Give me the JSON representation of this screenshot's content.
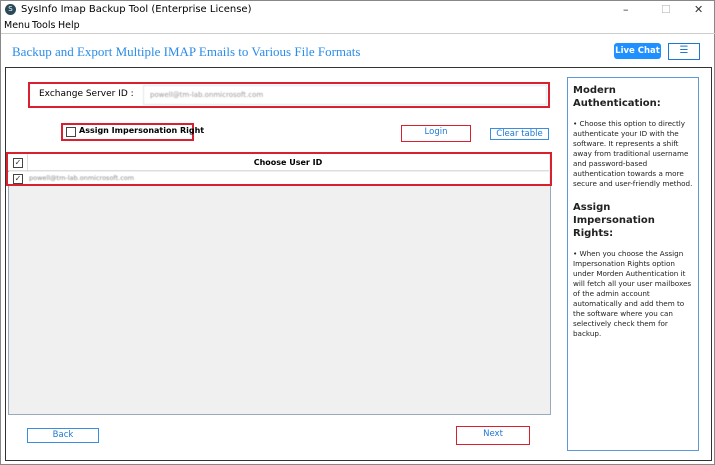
{
  "window": {
    "title": "SysInfo Imap Backup Tool (Enterprise License)",
    "minimize": "–",
    "maximize": "☐",
    "close": "✕"
  },
  "menu": [
    "Menu",
    "Tools",
    "Help"
  ],
  "header": {
    "title": "Backup and Export Multiple IMAP Emails to Various File Formats",
    "live_chat": "Live Chat",
    "menu_icon": "☰"
  },
  "form": {
    "server_label": "Exchange Server ID :",
    "server_value": "powell@tm-lab.onmicrosoft.com",
    "impersonation_label": "Assign Impersonation Right",
    "impersonation_checked": false,
    "login": "Login",
    "clear_table": "Clear table"
  },
  "table": {
    "header": "Choose User ID",
    "rows": [
      {
        "email": "powell@tm-lab.onmicrosoft.com",
        "checked": true
      }
    ]
  },
  "side": {
    "h1": "Modern Authentication:",
    "p1": "• Choose this option to directly authenticate your ID with the software. It represents a shift away from traditional username and password-based authentication towards a more secure and user-friendly method.",
    "h2": "Assign Impersonation Rights:",
    "p2": "• When you choose the Assign Impersonation Rights option under Morden Authentication it will fetch all your user mailboxes of the admin account automatically and add them to the software where you can selectively check them for backup."
  },
  "footer": {
    "back": "Back",
    "next": "Next"
  }
}
